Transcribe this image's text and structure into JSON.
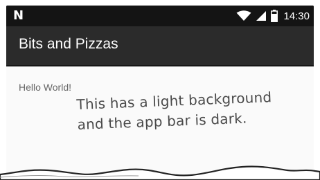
{
  "status_bar": {
    "left_icon": "N",
    "icons": [
      "wifi-icon",
      "signal-icon",
      "battery-icon"
    ],
    "time": "14:30"
  },
  "app_bar": {
    "title": "Bits and Pizzas"
  },
  "content": {
    "text": "Hello World!"
  },
  "annotation": {
    "line1": "This has a light background",
    "line2": "and the app bar is dark."
  },
  "colors": {
    "status_bar": "#141414",
    "app_bar": "#2b2b2b",
    "content_background": "#fafafa",
    "text_secondary": "#666666"
  }
}
